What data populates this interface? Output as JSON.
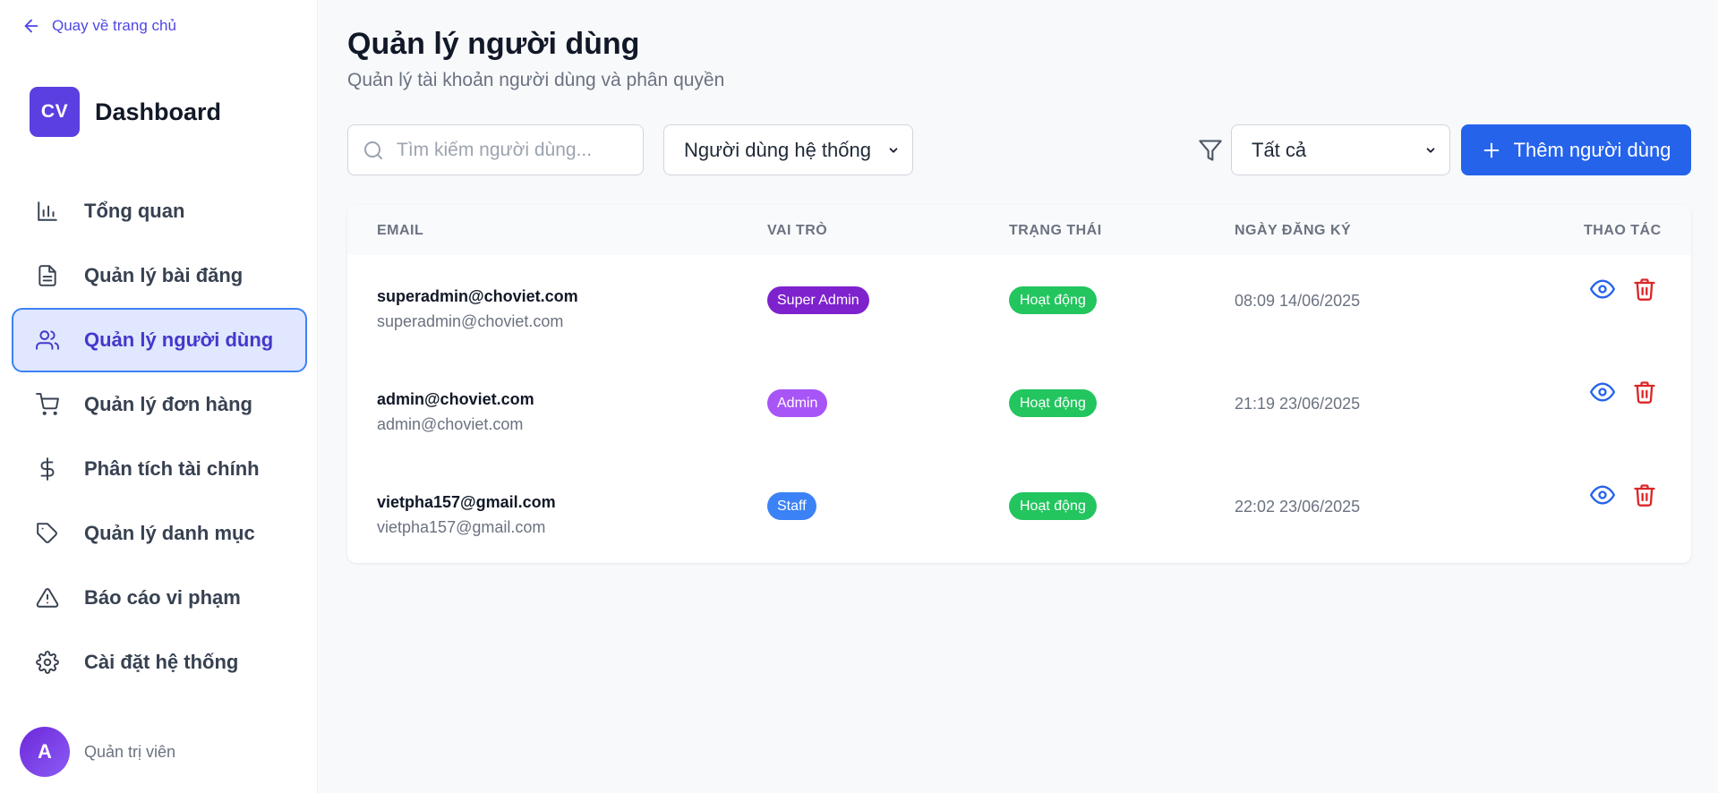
{
  "sidebar": {
    "back_label": "Quay về trang chủ",
    "brand_logo": "CV",
    "brand_title": "Dashboard",
    "items": [
      {
        "label": "Tổng quan",
        "icon": "bar-chart-icon"
      },
      {
        "label": "Quản lý bài đăng",
        "icon": "document-icon"
      },
      {
        "label": "Quản lý người dùng",
        "icon": "users-icon",
        "active": true
      },
      {
        "label": "Quản lý đơn hàng",
        "icon": "cart-icon"
      },
      {
        "label": "Phân tích tài chính",
        "icon": "dollar-icon"
      },
      {
        "label": "Quản lý danh mục",
        "icon": "tag-icon"
      },
      {
        "label": "Báo cáo vi phạm",
        "icon": "warning-icon"
      },
      {
        "label": "Cài đặt hệ thống",
        "icon": "gear-icon"
      }
    ],
    "user": {
      "avatar": "A",
      "name": "Quản trị viên"
    }
  },
  "header": {
    "title": "Quản lý người dùng",
    "subtitle": "Quản lý tài khoản người dùng và phân quyền"
  },
  "toolbar": {
    "search_placeholder": "Tìm kiếm người dùng...",
    "type_select": "Người dùng hệ thống",
    "status_select": "Tất cả",
    "add_label": "Thêm người dùng"
  },
  "table": {
    "columns": [
      "EMAIL",
      "VAI TRÒ",
      "TRẠNG THÁI",
      "NGÀY ĐĂNG KÝ",
      "THAO TÁC"
    ],
    "rows": [
      {
        "email": "superadmin@choviet.com",
        "email_sub": "superadmin@choviet.com",
        "role": "Super Admin",
        "role_color": "#7e22ce",
        "status": "Hoạt động",
        "date": "08:09 14/06/2025"
      },
      {
        "email": "admin@choviet.com",
        "email_sub": "admin@choviet.com",
        "role": "Admin",
        "role_color": "#a855f7",
        "status": "Hoạt động",
        "date": "21:19 23/06/2025"
      },
      {
        "email": "vietpha157@gmail.com",
        "email_sub": "vietpha157@gmail.com",
        "role": "Staff",
        "role_color": "#3b82f6",
        "status": "Hoạt động",
        "date": "22:02 23/06/2025"
      }
    ]
  },
  "colors": {
    "accent": "#2563eb",
    "brand": "#5b3fe0",
    "status_active": "#22c55e",
    "danger": "#dc2626"
  }
}
